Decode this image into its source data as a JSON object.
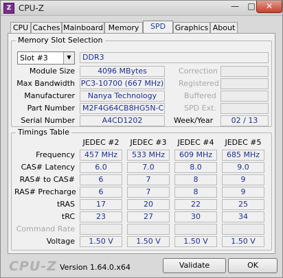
{
  "window": {
    "title": "CPU-Z",
    "icon_text": "Z"
  },
  "tabs": [
    "CPU",
    "Caches",
    "Mainboard",
    "Memory",
    "SPD",
    "Graphics",
    "About"
  ],
  "active_tab": "SPD",
  "slot_section": {
    "title": "Memory Slot Selection",
    "slot_selected": "Slot #3",
    "memory_type": "DDR3",
    "labels": {
      "module_size": "Module Size",
      "max_bandwidth": "Max Bandwidth",
      "manufacturer": "Manufacturer",
      "part_number": "Part Number",
      "serial_number": "Serial Number",
      "week_year": "Week/Year"
    },
    "values": {
      "module_size": "4096 MBytes",
      "max_bandwidth": "PC3-10700 (667 MHz)",
      "manufacturer": "Nanya Technology",
      "part_number": "M2F4G64CB8HG5N-CG",
      "serial_number": "A4CD1202",
      "week_year": "02 / 13"
    },
    "right_labels": {
      "correction": "Correction",
      "registered": "Registered",
      "buffered": "Buffered",
      "spd_ext": "SPD Ext."
    }
  },
  "timings": {
    "title": "Timings Table",
    "columns": [
      "JEDEC #2",
      "JEDEC #3",
      "JEDEC #4",
      "JEDEC #5"
    ],
    "rows": [
      {
        "label": "Frequency",
        "values": [
          "457 MHz",
          "533 MHz",
          "609 MHz",
          "685 MHz"
        ]
      },
      {
        "label": "CAS# Latency",
        "values": [
          "6.0",
          "7.0",
          "8.0",
          "9.0"
        ]
      },
      {
        "label": "RAS# to CAS#",
        "values": [
          "6",
          "7",
          "8",
          "9"
        ]
      },
      {
        "label": "RAS# Precharge",
        "values": [
          "6",
          "7",
          "8",
          "9"
        ]
      },
      {
        "label": "tRAS",
        "values": [
          "17",
          "20",
          "22",
          "25"
        ]
      },
      {
        "label": "tRC",
        "values": [
          "23",
          "27",
          "30",
          "34"
        ]
      },
      {
        "label": "Command Rate",
        "values": [
          "",
          "",
          "",
          ""
        ],
        "disabled": true
      },
      {
        "label": "Voltage",
        "values": [
          "1.50 V",
          "1.50 V",
          "1.50 V",
          "1.50 V"
        ]
      }
    ]
  },
  "footer": {
    "logo": "CPU-Z",
    "version": "Version 1.64.0.x64",
    "validate_label": "Validate",
    "ok_label": "OK"
  }
}
